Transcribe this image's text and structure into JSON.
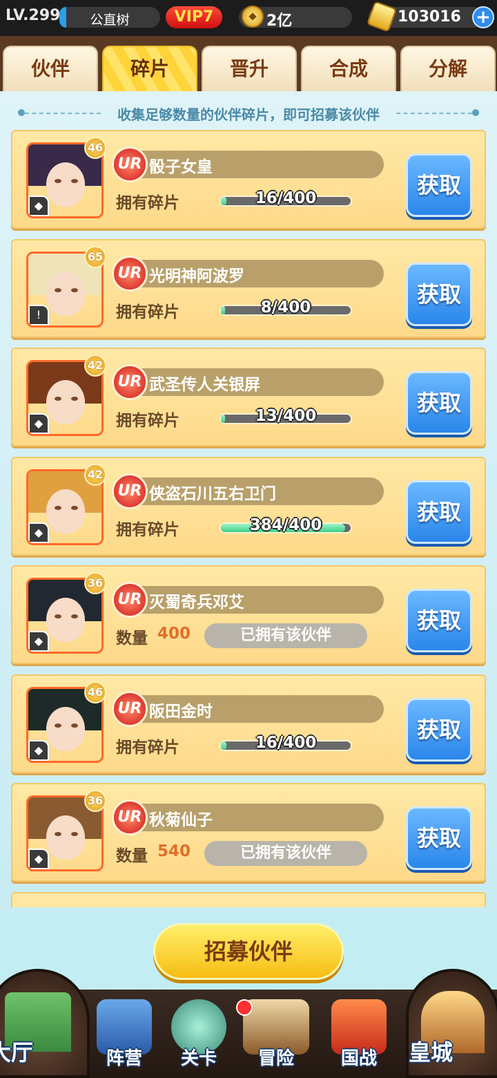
{
  "topbar": {
    "level": "LV.299",
    "player_name": "公直树",
    "vip": "VIP7",
    "coins": "2亿",
    "gold": "103016",
    "add_label": "+"
  },
  "tabs": [
    {
      "label": "伙伴",
      "active": false
    },
    {
      "label": "碎片",
      "active": true
    },
    {
      "label": "晋升",
      "active": false
    },
    {
      "label": "合成",
      "active": false
    },
    {
      "label": "分解",
      "active": false
    }
  ],
  "hint": "收集足够数量的伙伴碎片，即可招募该伙伴",
  "cards": [
    {
      "level": "46",
      "rarity": "UR",
      "name": "骰子女皇",
      "label": "拥有碎片",
      "progress": "16/400",
      "fraction": 0.04,
      "owned": false,
      "button": "获取",
      "type_icon": "◆"
    },
    {
      "level": "65",
      "rarity": "UR",
      "name": "光明神阿波罗",
      "label": "拥有碎片",
      "progress": "8/400",
      "fraction": 0.02,
      "owned": false,
      "button": "获取",
      "type_icon": "!"
    },
    {
      "level": "42",
      "rarity": "UR",
      "name": "武圣传人关银屏",
      "label": "拥有碎片",
      "progress": "13/400",
      "fraction": 0.0325,
      "owned": false,
      "button": "获取",
      "type_icon": "◆"
    },
    {
      "level": "42",
      "rarity": "UR",
      "name": "侠盗石川五右卫门",
      "label": "拥有碎片",
      "progress": "384/400",
      "fraction": 0.96,
      "owned": false,
      "button": "获取",
      "type_icon": "◆"
    },
    {
      "level": "36",
      "rarity": "UR",
      "name": "灭蜀奇兵邓艾",
      "label": "数量",
      "quantity": "400",
      "status": "已拥有该伙伴",
      "owned": true,
      "button": "获取",
      "type_icon": "◆"
    },
    {
      "level": "46",
      "rarity": "UR",
      "name": "阪田金时",
      "label": "拥有碎片",
      "progress": "16/400",
      "fraction": 0.04,
      "owned": false,
      "button": "获取",
      "type_icon": "◆"
    },
    {
      "level": "36",
      "rarity": "UR",
      "name": "秋菊仙子",
      "label": "数量",
      "quantity": "540",
      "status": "已拥有该伙伴",
      "owned": true,
      "button": "获取",
      "type_icon": "◆"
    }
  ],
  "recruit_button": "招募伙伴",
  "nav": [
    {
      "label": "大厅"
    },
    {
      "label": "阵营"
    },
    {
      "label": "关卡"
    },
    {
      "label": "冒险"
    },
    {
      "label": "国战"
    },
    {
      "label": "皇城"
    }
  ],
  "colors": {
    "accent_blue": "#2a86ea",
    "recruit_yellow": "#f7bd14",
    "ur_red": "#d01818",
    "progress_green": "#3ecf8a"
  }
}
